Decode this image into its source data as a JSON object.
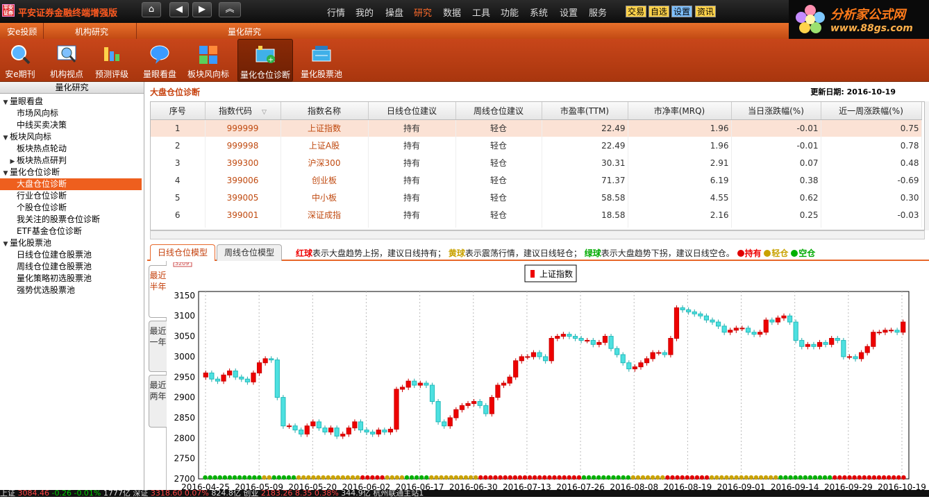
{
  "app": {
    "title": "平安证券金融终端增强版",
    "logo_text": "平安证券"
  },
  "nav": {
    "home_icon": "home-icon",
    "back_icon": "back-icon",
    "forward_icon": "forward-icon",
    "up_icon": "collapse-up-icon"
  },
  "menu": [
    "行情",
    "我的",
    "操盘",
    "研究",
    "数据",
    "工具",
    "功能",
    "系统",
    "设置",
    "服务"
  ],
  "menu_active": "研究",
  "quick_buttons": [
    "交易",
    "自选",
    "设置",
    "资讯"
  ],
  "brand": {
    "line1": "分析家公式网",
    "line2": "www.88gs.com"
  },
  "sections": [
    "安e投顾",
    "机构研究",
    "量化研究"
  ],
  "toolbar": [
    {
      "label": "安e期刊",
      "icon": "magnifier-globe-icon"
    },
    {
      "label": "机构视点",
      "icon": "magnifier-chart-icon"
    },
    {
      "label": "预测评级",
      "icon": "rating-bars-icon"
    },
    {
      "label": "量眼看盘",
      "icon": "speech-bubble-icon"
    },
    {
      "label": "板块风向标",
      "icon": "sector-blocks-icon"
    },
    {
      "label": "量化仓位诊断",
      "icon": "position-diagnosis-icon"
    },
    {
      "label": "量化股票池",
      "icon": "stock-pool-icon"
    }
  ],
  "sidebar": {
    "title": "量化研究",
    "items": [
      {
        "label": "量眼看盘",
        "level": 0,
        "expander": "▼"
      },
      {
        "label": "市场风向标",
        "level": 1,
        "expander": ""
      },
      {
        "label": "中线买卖决策",
        "level": 1,
        "expander": ""
      },
      {
        "label": "板块风向标",
        "level": 0,
        "expander": "▼"
      },
      {
        "label": "板块热点轮动",
        "level": 1,
        "expander": ""
      },
      {
        "label": "板块热点研判",
        "level": 1,
        "expander": "▶"
      },
      {
        "label": "量化仓位诊断",
        "level": 0,
        "expander": "▼"
      },
      {
        "label": "大盘仓位诊断",
        "level": 1,
        "expander": "",
        "selected": true
      },
      {
        "label": "行业仓位诊断",
        "level": 1,
        "expander": ""
      },
      {
        "label": "个股仓位诊断",
        "level": 1,
        "expander": ""
      },
      {
        "label": "我关注的股票仓位诊断",
        "level": 1,
        "expander": ""
      },
      {
        "label": "ETF基金仓位诊断",
        "level": 1,
        "expander": ""
      },
      {
        "label": "量化股票池",
        "level": 0,
        "expander": "▼"
      },
      {
        "label": "日线仓位建仓股票池",
        "level": 1,
        "expander": ""
      },
      {
        "label": "周线仓位建仓股票池",
        "level": 1,
        "expander": ""
      },
      {
        "label": "量化策略初选股票池",
        "level": 1,
        "expander": ""
      },
      {
        "label": "强势优选股票池",
        "level": 1,
        "expander": ""
      }
    ]
  },
  "page": {
    "title": "大盘仓位诊断",
    "update_label": "更新日期:",
    "update_date": "2016-10-19"
  },
  "table": {
    "columns": [
      "序号",
      "指数代码",
      "指数名称",
      "日线仓位建议",
      "周线仓位建议",
      "市盈率(TTM)",
      "市净率(MRQ)",
      "当日涨跌幅(%)",
      "近一周涨跌幅(%)"
    ],
    "sort_indicator": "▽",
    "rows": [
      [
        "1",
        "999999",
        "上证指数",
        "持有",
        "轻仓",
        "22.49",
        "1.96",
        "-0.01",
        "0.75"
      ],
      [
        "2",
        "999998",
        "上证A股",
        "持有",
        "轻仓",
        "22.49",
        "1.96",
        "-0.01",
        "0.78"
      ],
      [
        "3",
        "399300",
        "沪深300",
        "持有",
        "轻仓",
        "30.31",
        "2.91",
        "0.07",
        "0.48"
      ],
      [
        "4",
        "399006",
        "创业板",
        "持有",
        "轻仓",
        "71.37",
        "6.19",
        "0.38",
        "-0.69"
      ],
      [
        "5",
        "399005",
        "中小板",
        "持有",
        "轻仓",
        "58.58",
        "4.55",
        "0.62",
        "0.30"
      ],
      [
        "6",
        "399001",
        "深证成指",
        "持有",
        "轻仓",
        "18.58",
        "2.16",
        "0.25",
        "-0.03"
      ]
    ]
  },
  "chart_tabs": [
    "日线仓位模型",
    "周线仓位模型"
  ],
  "legend_text": {
    "red": "红球",
    "red_desc": "表示大盘趋势上拐，建议日线持有；",
    "yellow": "黄球",
    "yellow_desc": "表示震荡行情，建议日线轻仓；",
    "green": "绿球",
    "green_desc": "表示大盘趋势下拐，建议日线空仓。",
    "k_red": "持有",
    "k_yellow": "轻仓",
    "k_green": "空仓",
    "c_red": "#e00000",
    "c_yellow": "#c9a200",
    "c_green": "#00b000"
  },
  "range_tabs": [
    "最近半年",
    "最近一年",
    "最近两年"
  ],
  "chart_data": {
    "type": "candlestick",
    "series_name": "上证指数",
    "legend_label": "上证指数",
    "ylim": [
      2700,
      3160
    ],
    "yticks": [
      2700,
      2750,
      2800,
      2850,
      2900,
      2950,
      3000,
      3050,
      3100,
      3150
    ],
    "xtick_labels": [
      "2016-04-25",
      "2016-05-09",
      "2016-05-20",
      "2016-06-02",
      "2016-06-17",
      "2016-06-30",
      "2016-07-13",
      "2016-07-26",
      "2016-08-08",
      "2016-08-19",
      "2016-09-01",
      "2016-09-14",
      "2016-09-29",
      "2016-10-19"
    ],
    "top_partial_label": "3209",
    "closes": [
      2960,
      2945,
      2940,
      2955,
      2965,
      2950,
      2945,
      2938,
      2960,
      2985,
      2995,
      2992,
      2900,
      2830,
      2830,
      2820,
      2810,
      2830,
      2840,
      2825,
      2815,
      2825,
      2805,
      2810,
      2825,
      2840,
      2820,
      2815,
      2810,
      2820,
      2815,
      2822,
      2920,
      2925,
      2940,
      2930,
      2935,
      2930,
      2890,
      2840,
      2830,
      2850,
      2870,
      2880,
      2885,
      2890,
      2880,
      2860,
      2900,
      2930,
      2935,
      2950,
      2990,
      3000,
      3000,
      3010,
      3000,
      2990,
      3045,
      3050,
      3055,
      3050,
      3045,
      3040,
      3040,
      3030,
      3035,
      3050,
      3020,
      3005,
      2985,
      2970,
      2975,
      2985,
      2995,
      3010,
      3010,
      3005,
      3045,
      3120,
      3115,
      3110,
      3105,
      3100,
      3090,
      3085,
      3075,
      3060,
      3065,
      3070,
      3070,
      3060,
      3055,
      3060,
      3090,
      3085,
      3095,
      3100,
      3085,
      3040,
      3025,
      3030,
      3025,
      3035,
      3030,
      3045,
      3040,
      3000,
      3000,
      2995,
      3010,
      3025,
      3060,
      3060,
      3065,
      3065,
      3060,
      3085
    ],
    "position_signals": "GGGGGGGGGGGGYYGGGGGYYYYYYYYYYYYYRRRRRYYYYGGGGGYYYYYYYYYYRRRRRRRRRRRRRRRRRRRRRGGGGGGGGGGYYYYYYYRRRRRRRRRYYYYYYYYYYYYYYGGGGGGGGGGGRRRRRRRRRRRRRRR"
  },
  "status": {
    "sh": "上证",
    "sh_val": "3084.46",
    "sh_chg": "-0.26",
    "sh_pct": "-0.01%",
    "sh_amt": "1777亿",
    "sz": "深证",
    "sz_val": "3318.60",
    "sz_pct": "0.07%",
    "sz_amt": "824.8亿",
    "cyb": "创业",
    "cyb_val": "2183.26",
    "cyb_chg": "8.35",
    "cyb_pct": "0.38%",
    "cyb_amt": "344.9亿",
    "server": "杭州联通主站1"
  }
}
